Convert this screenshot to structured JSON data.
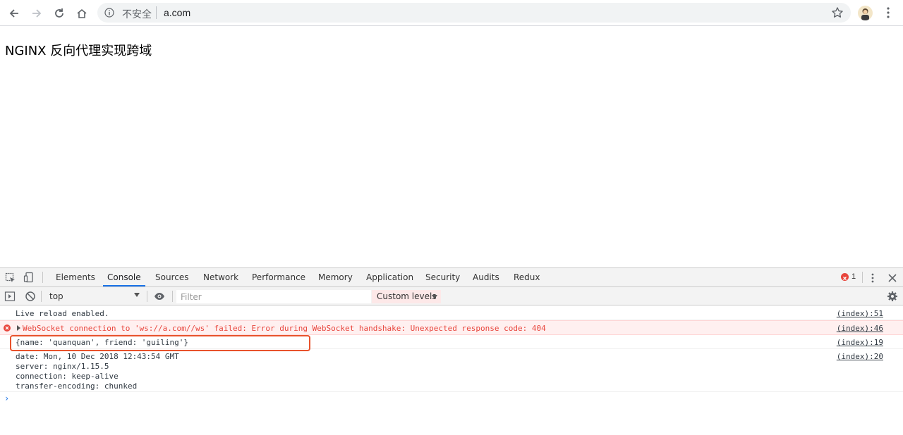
{
  "browser": {
    "security_label": "不安全",
    "url": "a.com"
  },
  "page": {
    "heading": "NGINX 反向代理实现跨域"
  },
  "devtools": {
    "tabs": [
      "Elements",
      "Console",
      "Sources",
      "Network",
      "Performance",
      "Memory",
      "Application",
      "Security",
      "Audits",
      "Redux"
    ],
    "active_tab": "Console",
    "error_count": "1",
    "context": "top",
    "filter_placeholder": "Filter",
    "levels_label": "Custom levels",
    "accent_color": "#1a73e8",
    "error_color": "#e8453c"
  },
  "console": {
    "lines": [
      {
        "text": "Live reload enabled.",
        "source": "(index):51",
        "level": "log"
      },
      {
        "text": "WebSocket connection to 'ws://a.com//ws' failed: Error during WebSocket handshake: Unexpected response code: 404",
        "source": "(index):46",
        "level": "error"
      },
      {
        "text": "{name: 'quanquan', friend: 'guiling'}",
        "source": "(index):19",
        "level": "log"
      },
      {
        "text": "date: Mon, 10 Dec 2018 12:43:54 GMT\nserver: nginx/1.15.5\nconnection: keep-alive\ntransfer-encoding: chunked",
        "source": "(index):20",
        "level": "log"
      }
    ]
  }
}
